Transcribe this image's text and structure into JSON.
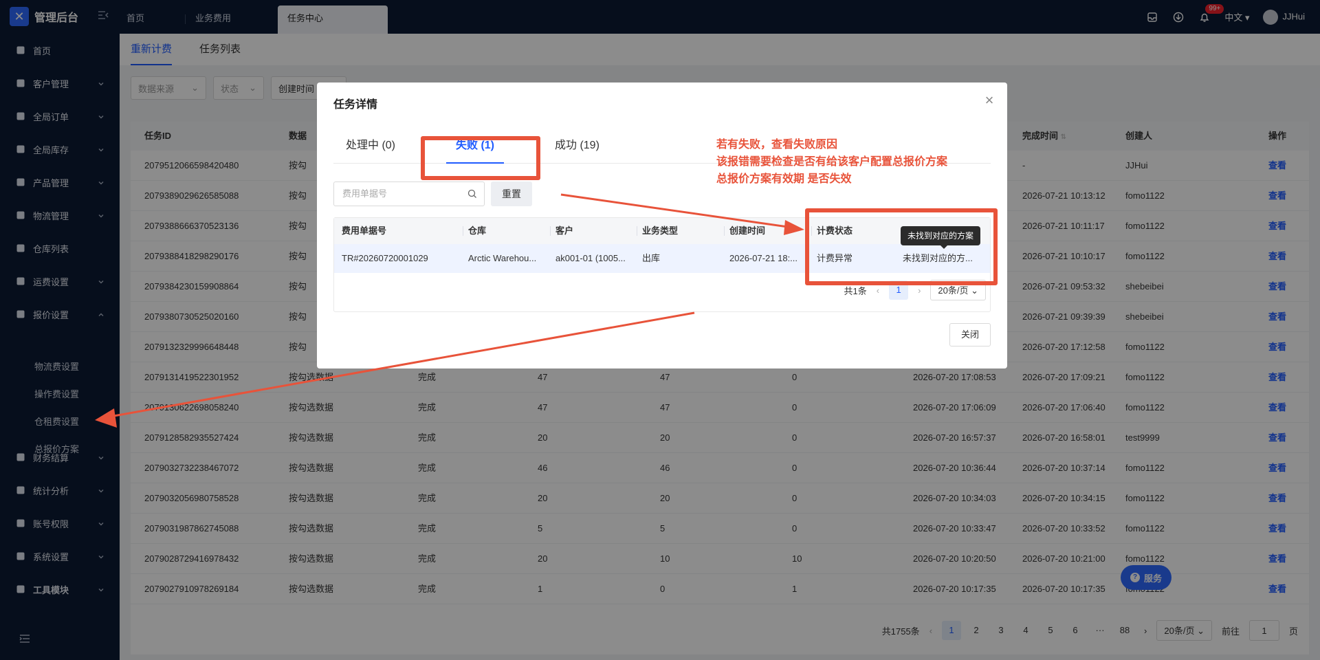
{
  "app": {
    "title": "管理后台"
  },
  "header": {
    "tabs": [
      {
        "label": "首页"
      },
      {
        "label": "业务费用"
      },
      {
        "label": "任务中心"
      }
    ],
    "badge": "99+",
    "language": "中文",
    "user": "JJHui"
  },
  "sidebar": {
    "items": [
      {
        "label": "首页",
        "icon": "home-icon"
      },
      {
        "label": "客户管理",
        "icon": "users-icon"
      },
      {
        "label": "全局订单",
        "icon": "order-icon"
      },
      {
        "label": "全局库存",
        "icon": "inventory-icon"
      },
      {
        "label": "产品管理",
        "icon": "product-icon"
      },
      {
        "label": "物流管理",
        "icon": "truck-icon"
      },
      {
        "label": "仓库列表",
        "icon": "warehouse-icon"
      },
      {
        "label": "运费设置",
        "icon": "freight-icon"
      },
      {
        "label": "报价设置",
        "icon": "quote-icon"
      },
      {
        "label": "财务结算",
        "icon": "finance-icon"
      },
      {
        "label": "统计分析",
        "icon": "stats-icon"
      },
      {
        "label": "账号权限",
        "icon": "account-icon"
      },
      {
        "label": "系统设置",
        "icon": "settings-icon"
      },
      {
        "label": "工具模块",
        "icon": "tools-icon"
      }
    ],
    "sub_items": [
      {
        "label": "物流费设置"
      },
      {
        "label": "操作费设置"
      },
      {
        "label": "仓租费设置"
      },
      {
        "label": "总报价方案"
      }
    ]
  },
  "main": {
    "subtabs": [
      {
        "label": "重新计费"
      },
      {
        "label": "任务列表"
      }
    ],
    "filters": {
      "source": "数据来源",
      "status": "状态",
      "created": "创建时间"
    },
    "table": {
      "headers": [
        "任务ID",
        "数据",
        "完成时间",
        "创建人",
        "操作"
      ],
      "rows": [
        {
          "id": "2079512066598420480",
          "type": "按勾",
          "status": "",
          "c1": "",
          "c2": "",
          "c3": "",
          "start": "",
          "done": "-",
          "creator": "JJHui",
          "action": "查看"
        },
        {
          "id": "2079389029626585088",
          "type": "按勾",
          "status": "",
          "c1": "",
          "c2": "",
          "c3": "",
          "start": "",
          "done": "2026-07-21 10:13:12",
          "creator": "fomo1122",
          "action": "查看"
        },
        {
          "id": "2079388666370523136",
          "type": "按勾",
          "status": "",
          "c1": "",
          "c2": "",
          "c3": "",
          "start": "",
          "done": "2026-07-21 10:11:17",
          "creator": "fomo1122",
          "action": "查看"
        },
        {
          "id": "2079388418298290176",
          "type": "按勾",
          "status": "",
          "c1": "",
          "c2": "",
          "c3": "",
          "start": "",
          "done": "2026-07-21 10:10:17",
          "creator": "fomo1122",
          "action": "查看"
        },
        {
          "id": "2079384230159908864",
          "type": "按勾",
          "status": "",
          "c1": "",
          "c2": "",
          "c3": "",
          "start": "",
          "done": "2026-07-21 09:53:32",
          "creator": "shebeibei",
          "action": "查看"
        },
        {
          "id": "2079380730525020160",
          "type": "按勾",
          "status": "",
          "c1": "",
          "c2": "",
          "c3": "",
          "start": "",
          "done": "2026-07-21 09:39:39",
          "creator": "shebeibei",
          "action": "查看"
        },
        {
          "id": "2079132329996648448",
          "type": "按勾",
          "status": "",
          "c1": "",
          "c2": "",
          "c3": "",
          "start": "",
          "done": "2026-07-20 17:12:58",
          "creator": "fomo1122",
          "action": "查看"
        },
        {
          "id": "2079131419522301952",
          "type": "按勾选数据",
          "status": "完成",
          "c1": "47",
          "c2": "47",
          "c3": "0",
          "start": "2026-07-20 17:08:53",
          "done": "2026-07-20 17:09:21",
          "creator": "fomo1122",
          "action": "查看"
        },
        {
          "id": "2079130622698058240",
          "type": "按勾选数据",
          "status": "完成",
          "c1": "47",
          "c2": "47",
          "c3": "0",
          "start": "2026-07-20 17:06:09",
          "done": "2026-07-20 17:06:40",
          "creator": "fomo1122",
          "action": "查看"
        },
        {
          "id": "2079128582935527424",
          "type": "按勾选数据",
          "status": "完成",
          "c1": "20",
          "c2": "20",
          "c3": "0",
          "start": "2026-07-20 16:57:37",
          "done": "2026-07-20 16:58:01",
          "creator": "test9999",
          "action": "查看"
        },
        {
          "id": "2079032732238467072",
          "type": "按勾选数据",
          "status": "完成",
          "c1": "46",
          "c2": "46",
          "c3": "0",
          "start": "2026-07-20 10:36:44",
          "done": "2026-07-20 10:37:14",
          "creator": "fomo1122",
          "action": "查看"
        },
        {
          "id": "2079032056980758528",
          "type": "按勾选数据",
          "status": "完成",
          "c1": "20",
          "c2": "20",
          "c3": "0",
          "start": "2026-07-20 10:34:03",
          "done": "2026-07-20 10:34:15",
          "creator": "fomo1122",
          "action": "查看"
        },
        {
          "id": "2079031987862745088",
          "type": "按勾选数据",
          "status": "完成",
          "c1": "5",
          "c2": "5",
          "c3": "0",
          "start": "2026-07-20 10:33:47",
          "done": "2026-07-20 10:33:52",
          "creator": "fomo1122",
          "action": "查看"
        },
        {
          "id": "2079028729416978432",
          "type": "按勾选数据",
          "status": "完成",
          "c1": "20",
          "c2": "10",
          "c3": "10",
          "start": "2026-07-20 10:20:50",
          "done": "2026-07-20 10:21:00",
          "creator": "fomo1122",
          "action": "查看"
        },
        {
          "id": "2079027910978269184",
          "type": "按勾选数据",
          "status": "完成",
          "c1": "1",
          "c2": "0",
          "c3": "1",
          "start": "2026-07-20 10:17:35",
          "done": "2026-07-20 10:17:35",
          "creator": "fomo1122",
          "action": "查看"
        }
      ]
    },
    "pager": {
      "total": "共1755条",
      "pages": [
        "1",
        "2",
        "3",
        "4",
        "5",
        "6",
        "···",
        "88"
      ],
      "size": "20条/页",
      "goto": "前往",
      "goto_value": "1",
      "page_unit": "页"
    },
    "service": "服务"
  },
  "modal": {
    "title": "任务详情",
    "tabs": [
      {
        "label": "处理中 (0)"
      },
      {
        "label": "失败 (1)"
      },
      {
        "label": "成功 (19)"
      }
    ],
    "search_placeholder": "费用单据号",
    "reset": "重置",
    "headers": [
      "费用单据号",
      "仓库",
      "客户",
      "业务类型",
      "创建时间",
      "计费状态"
    ],
    "row": {
      "doc_no": "TR#20260720001029",
      "warehouse": "Arctic Warehou...",
      "customer": "ak001-01 (1005...",
      "biz_type": "出库",
      "created": "2026-07-21 18:...",
      "status": "计费异常",
      "reason": "未找到对应的方..."
    },
    "pager": {
      "total": "共1条",
      "page": "1",
      "size": "20条/页"
    },
    "close": "关闭",
    "tooltip": "未找到对应的方案"
  },
  "annotation": {
    "lines": [
      "若有失败，查看失败原因",
      "该报错需要检查是否有给该客户配置总报价方案",
      "总报价方案有效期 是否失效"
    ],
    "color": "#e8533a"
  }
}
